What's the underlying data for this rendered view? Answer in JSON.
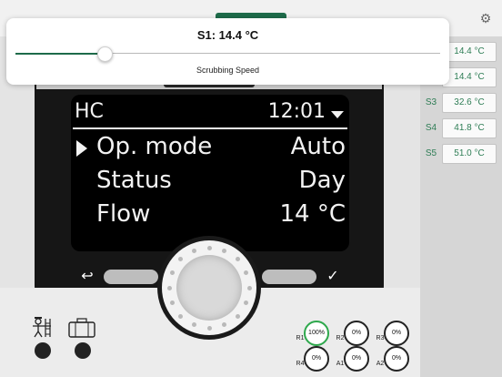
{
  "popup": {
    "title": "S1: 14.4 °C",
    "caption": "Scrubbing Speed",
    "slider_fraction": 0.21
  },
  "sensors": [
    {
      "label": "",
      "value": "14.4 °C"
    },
    {
      "label": "",
      "value": "14.4 °C"
    },
    {
      "label": "S3",
      "value": "32.6 °C"
    },
    {
      "label": "S4",
      "value": "41.8 °C"
    },
    {
      "label": "S5",
      "value": "51.0 °C"
    }
  ],
  "lcd": {
    "menu": "HC",
    "time": "12:01",
    "rows": [
      {
        "label": "Op. mode",
        "value": "Auto"
      },
      {
        "label": "Status",
        "value": "Day"
      },
      {
        "label": "Flow",
        "value": "14 °C"
      }
    ]
  },
  "relays": [
    {
      "label": "R1",
      "value": "100%",
      "active": true
    },
    {
      "label": "R2",
      "value": "0%",
      "active": false
    },
    {
      "label": "R3",
      "value": "0%",
      "active": false
    },
    {
      "label": "R4",
      "value": "0%",
      "active": false
    },
    {
      "label": "A1",
      "value": "0%",
      "active": false
    },
    {
      "label": "A2",
      "value": "0%",
      "active": false
    }
  ],
  "icons": {
    "gear": "gear-icon",
    "back": "back-arrow-icon",
    "ok": "checkmark-icon",
    "chimney": "chimney-sweep-icon",
    "case": "briefcase-icon",
    "dropdown": "triangle-down-icon",
    "cursor": "triangle-right-icon"
  },
  "colors": {
    "accent": "#1e6b4a",
    "relay_on": "#2ea84c",
    "sensor_text": "#2e7d55"
  }
}
